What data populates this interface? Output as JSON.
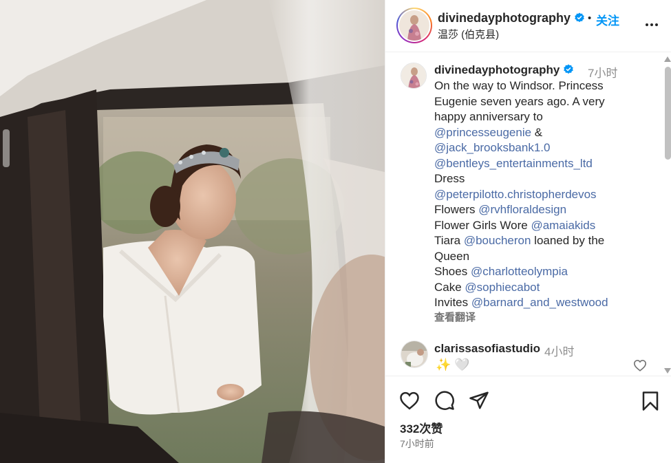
{
  "post": {
    "username": "divinedayphotography",
    "follow_label": "关注",
    "separator": "•",
    "location": "温莎 (伯克县)"
  },
  "caption": {
    "username": "divinedayphotography",
    "time": "7小时",
    "lines": [
      {
        "text": "On the way to Windsor. Princess"
      },
      {
        "text": "Eugenie seven years ago. A very"
      },
      {
        "text": "happy anniversary to"
      },
      {
        "mention": "@princesseugenie",
        "after": " &"
      },
      {
        "mention": "@jack_brooksbank1.0"
      },
      {
        "mention": "@bentleys_entertainments_ltd"
      },
      {
        "text": "Dress"
      },
      {
        "mention": "@peterpilotto.christopherdevos"
      },
      {
        "before": "Flowers ",
        "mention": "@rvhfloraldesign"
      },
      {
        "before": "Flower Girls Wore ",
        "mention": "@amaiakids"
      },
      {
        "before": "Tiara ",
        "mention": "@boucheron",
        "after": " loaned by the"
      },
      {
        "text": "Queen"
      },
      {
        "before": "Shoes ",
        "mention": "@charlotteolympia"
      },
      {
        "before": "Cake ",
        "mention": "@sophiecabot"
      },
      {
        "before": "Invites ",
        "mention": "@barnard_and_westwood"
      }
    ],
    "translate_label": "查看翻译"
  },
  "comment": {
    "username": "clarissasofiastudio",
    "time": "4小时",
    "text": "✨ 🤍"
  },
  "footer": {
    "likes": "332次赞",
    "timestamp": "7小时前"
  },
  "icons": {
    "verified": "verified-badge-icon",
    "more": "more-options-icon",
    "like": "heart-icon",
    "comment": "comment-icon",
    "share": "share-icon",
    "save": "bookmark-icon"
  },
  "colors": {
    "accent": "#0095f6",
    "mention": "#4a6aa5",
    "muted": "#8e8e8e",
    "text": "#262626"
  }
}
